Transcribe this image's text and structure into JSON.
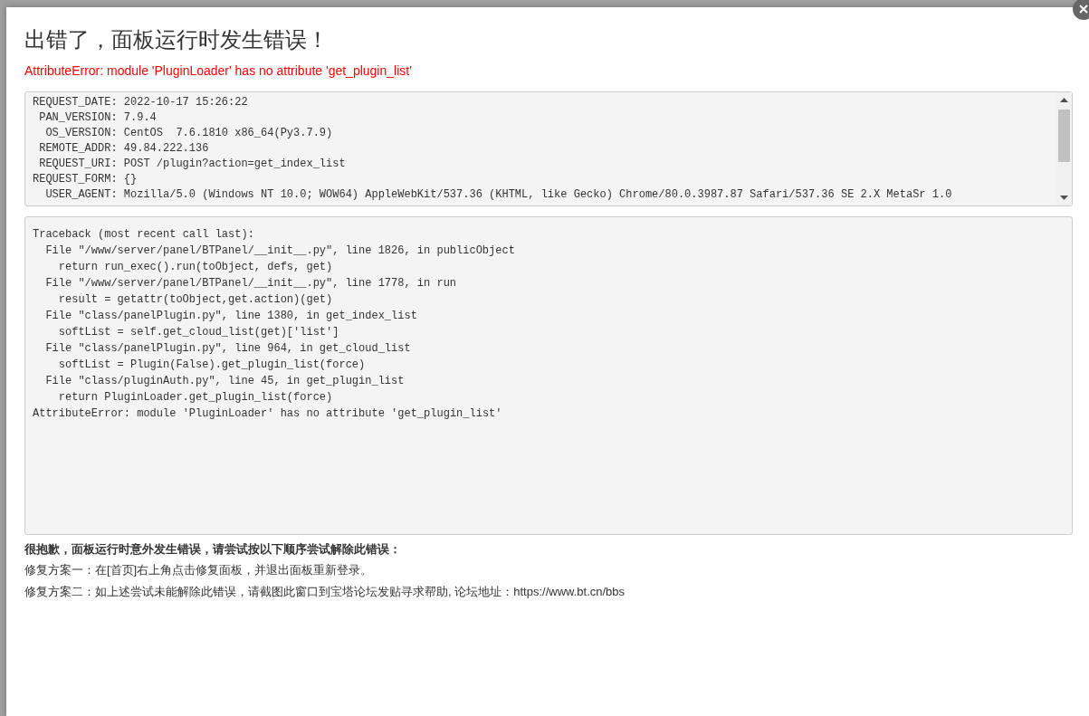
{
  "dialog": {
    "title": "出错了，面板运行时发生错误！",
    "error_message": "AttributeError: module 'PluginLoader' has no attribute 'get_plugin_list'",
    "request_info": [
      {
        "label": "REQUEST_DATE:",
        "value": "2022-10-17 15:26:22"
      },
      {
        "label": "PAN_VERSION:",
        "value": "7.9.4"
      },
      {
        "label": "OS_VERSION:",
        "value": "CentOS  7.6.1810 x86_64(Py3.7.9)"
      },
      {
        "label": "REMOTE_ADDR:",
        "value": "49.84.222.136"
      },
      {
        "label": "REQUEST_URI:",
        "value": "POST /plugin?action=get_index_list"
      },
      {
        "label": "REQUEST_FORM:",
        "value": "{}"
      },
      {
        "label": "USER_AGENT:",
        "value": "Mozilla/5.0 (Windows NT 10.0; WOW64) AppleWebKit/537.36 (KHTML, like Gecko) Chrome/80.0.3987.87 Safari/537.36 SE 2.X MetaSr 1.0"
      }
    ],
    "traceback": {
      "header": "Traceback (most recent call last):",
      "frames": [
        {
          "location": "File \"/www/server/panel/BTPanel/__init__.py\", line 1826, in publicObject",
          "code": "return run_exec().run(toObject, defs, get)"
        },
        {
          "location": "File \"/www/server/panel/BTPanel/__init__.py\", line 1778, in run",
          "code": "result = getattr(toObject,get.action)(get)"
        },
        {
          "location": "File \"class/panelPlugin.py\", line 1380, in get_index_list",
          "code": "softList = self.get_cloud_list(get)['list']"
        },
        {
          "location": "File \"class/panelPlugin.py\", line 964, in get_cloud_list",
          "code": "softList = Plugin(False).get_plugin_list(force)"
        },
        {
          "location": "File \"class/pluginAuth.py\", line 45, in get_plugin_list",
          "code": "return PluginLoader.get_plugin_list(force)"
        }
      ],
      "error": "AttributeError: module 'PluginLoader' has no attribute 'get_plugin_list'"
    },
    "help": {
      "heading": "很抱歉，面板运行时意外发生错误，请尝试按以下顺序尝试解除此错误：",
      "steps": [
        "修复方案一：在[首页]右上角点击修复面板，并退出面板重新登录。",
        "修复方案二：如上述尝试未能解除此错误，请截图此窗口到宝塔论坛发贴寻求帮助, 论坛地址：https://www.bt.cn/bbs"
      ]
    }
  }
}
